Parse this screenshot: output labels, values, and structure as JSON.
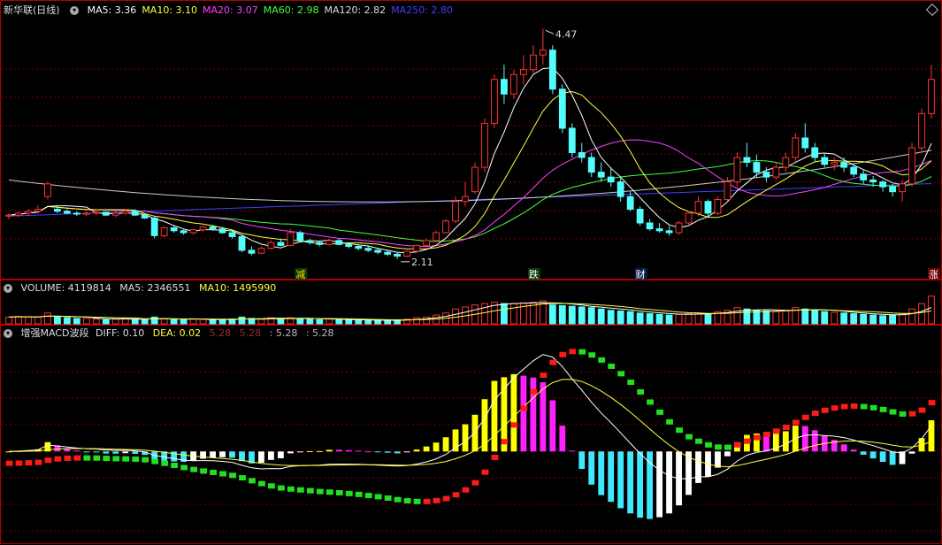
{
  "app": {
    "stock_name": "新华联",
    "period": "(日线)"
  },
  "main_indicators": [
    {
      "label": "MA5: 3.36",
      "color": "#ffffff"
    },
    {
      "label": "MA10: 3.10",
      "color": "#ffff40"
    },
    {
      "label": "MA20: 3.07",
      "color": "#ff40ff"
    },
    {
      "label": "MA60: 2.98",
      "color": "#40ff40"
    },
    {
      "label": "MA120: 2.82",
      "color": "#dddddd"
    },
    {
      "label": "MA250: 2.80",
      "color": "#4040ff"
    }
  ],
  "volume_panel": {
    "title": "VOLUME: 4119814",
    "ma5": "MA5: 2346551",
    "ma10": "MA10: 1495990"
  },
  "macd_panel": {
    "title": "增强MACD波段",
    "diff": "DIFF: 0.10",
    "dea": "DEA: 0.02",
    "extra": [
      "5.28",
      "5.28",
      ": 5.28",
      ": 5.28"
    ]
  },
  "annotations": {
    "high": "4.47",
    "low": "2.11",
    "markers": [
      "减",
      "跌",
      "财",
      "涨"
    ]
  },
  "colors": {
    "up": "#ff3232",
    "down": "#54fcfc",
    "grid": "#7a0000",
    "border": "#b00000"
  },
  "chart_data": {
    "type": "candlestick",
    "price_ylim": [
      1.9,
      4.6
    ],
    "high_value": 4.47,
    "low_value": 2.11,
    "candles": [
      [
        2.55,
        2.58,
        2.52,
        2.56
      ],
      [
        2.56,
        2.6,
        2.54,
        2.58
      ],
      [
        2.58,
        2.62,
        2.55,
        2.6
      ],
      [
        2.6,
        2.66,
        2.58,
        2.62
      ],
      [
        2.75,
        2.9,
        2.72,
        2.88
      ],
      [
        2.62,
        2.66,
        2.58,
        2.6
      ],
      [
        2.6,
        2.62,
        2.57,
        2.58
      ],
      [
        2.58,
        2.6,
        2.55,
        2.57
      ],
      [
        2.57,
        2.6,
        2.55,
        2.58
      ],
      [
        2.58,
        2.61,
        2.56,
        2.59
      ],
      [
        2.59,
        2.6,
        2.55,
        2.56
      ],
      [
        2.56,
        2.6,
        2.54,
        2.58
      ],
      [
        2.58,
        2.62,
        2.56,
        2.6
      ],
      [
        2.6,
        2.62,
        2.55,
        2.56
      ],
      [
        2.56,
        2.58,
        2.52,
        2.53
      ],
      [
        2.53,
        2.55,
        2.32,
        2.35
      ],
      [
        2.35,
        2.45,
        2.33,
        2.43
      ],
      [
        2.43,
        2.45,
        2.38,
        2.4
      ],
      [
        2.4,
        2.42,
        2.36,
        2.38
      ],
      [
        2.38,
        2.42,
        2.36,
        2.41
      ],
      [
        2.41,
        2.45,
        2.39,
        2.44
      ],
      [
        2.44,
        2.46,
        2.4,
        2.42
      ],
      [
        2.42,
        2.44,
        2.37,
        2.38
      ],
      [
        2.38,
        2.4,
        2.32,
        2.34
      ],
      [
        2.34,
        2.36,
        2.18,
        2.2
      ],
      [
        2.2,
        2.24,
        2.15,
        2.17
      ],
      [
        2.17,
        2.24,
        2.16,
        2.22
      ],
      [
        2.22,
        2.3,
        2.21,
        2.28
      ],
      [
        2.28,
        2.32,
        2.24,
        2.25
      ],
      [
        2.25,
        2.42,
        2.24,
        2.38
      ],
      [
        2.38,
        2.4,
        2.28,
        2.3
      ],
      [
        2.3,
        2.32,
        2.26,
        2.28
      ],
      [
        2.28,
        2.3,
        2.24,
        2.26
      ],
      [
        2.26,
        2.32,
        2.25,
        2.3
      ],
      [
        2.3,
        2.32,
        2.25,
        2.26
      ],
      [
        2.26,
        2.28,
        2.22,
        2.24
      ],
      [
        2.24,
        2.26,
        2.2,
        2.22
      ],
      [
        2.22,
        2.24,
        2.18,
        2.2
      ],
      [
        2.2,
        2.22,
        2.16,
        2.18
      ],
      [
        2.18,
        2.2,
        2.14,
        2.16
      ],
      [
        2.16,
        2.18,
        2.11,
        2.14
      ],
      [
        2.14,
        2.2,
        2.13,
        2.19
      ],
      [
        2.19,
        2.26,
        2.18,
        2.25
      ],
      [
        2.25,
        2.32,
        2.24,
        2.3
      ],
      [
        2.3,
        2.4,
        2.29,
        2.38
      ],
      [
        2.38,
        2.52,
        2.37,
        2.5
      ],
      [
        2.5,
        2.75,
        2.48,
        2.7
      ],
      [
        2.7,
        2.9,
        2.65,
        2.75
      ],
      [
        2.8,
        3.1,
        2.78,
        3.05
      ],
      [
        3.05,
        3.55,
        3.0,
        3.5
      ],
      [
        3.5,
        4.0,
        3.45,
        3.95
      ],
      [
        3.95,
        4.1,
        3.7,
        3.8
      ],
      [
        3.8,
        4.05,
        3.75,
        4.0
      ],
      [
        4.0,
        4.2,
        3.9,
        4.05
      ],
      [
        4.05,
        4.3,
        4.0,
        4.2
      ],
      [
        4.2,
        4.47,
        4.1,
        4.25
      ],
      [
        4.25,
        4.3,
        3.8,
        3.85
      ],
      [
        3.85,
        3.9,
        3.4,
        3.45
      ],
      [
        3.45,
        3.5,
        3.15,
        3.2
      ],
      [
        3.2,
        3.3,
        3.1,
        3.15
      ],
      [
        3.15,
        3.2,
        2.95,
        3.0
      ],
      [
        3.0,
        3.1,
        2.9,
        2.95
      ],
      [
        2.95,
        3.05,
        2.85,
        2.9
      ],
      [
        2.9,
        2.95,
        2.7,
        2.75
      ],
      [
        2.75,
        2.8,
        2.6,
        2.62
      ],
      [
        2.62,
        2.65,
        2.45,
        2.48
      ],
      [
        2.48,
        2.52,
        2.4,
        2.42
      ],
      [
        2.42,
        2.48,
        2.38,
        2.4
      ],
      [
        2.4,
        2.45,
        2.35,
        2.38
      ],
      [
        2.38,
        2.5,
        2.36,
        2.48
      ],
      [
        2.48,
        2.6,
        2.45,
        2.58
      ],
      [
        2.58,
        2.75,
        2.55,
        2.7
      ],
      [
        2.7,
        2.72,
        2.55,
        2.58
      ],
      [
        2.58,
        2.75,
        2.56,
        2.72
      ],
      [
        2.72,
        2.95,
        2.7,
        2.9
      ],
      [
        2.9,
        3.2,
        2.85,
        3.15
      ],
      [
        3.15,
        3.3,
        3.05,
        3.1
      ],
      [
        3.1,
        3.18,
        2.95,
        3.0
      ],
      [
        3.0,
        3.05,
        2.9,
        2.95
      ],
      [
        2.95,
        3.1,
        2.92,
        3.05
      ],
      [
        3.05,
        3.2,
        3.0,
        3.15
      ],
      [
        3.15,
        3.4,
        3.1,
        3.35
      ],
      [
        3.35,
        3.5,
        3.2,
        3.25
      ],
      [
        3.25,
        3.3,
        3.1,
        3.15
      ],
      [
        3.15,
        3.2,
        3.05,
        3.08
      ],
      [
        3.08,
        3.15,
        3.02,
        3.1
      ],
      [
        3.1,
        3.15,
        3.0,
        3.05
      ],
      [
        3.05,
        3.08,
        2.95,
        2.98
      ],
      [
        2.98,
        3.02,
        2.88,
        2.92
      ],
      [
        2.92,
        2.96,
        2.85,
        2.9
      ],
      [
        2.9,
        2.92,
        2.8,
        2.85
      ],
      [
        2.85,
        2.88,
        2.75,
        2.8
      ],
      [
        2.8,
        2.92,
        2.7,
        2.88
      ],
      [
        2.88,
        3.3,
        2.85,
        3.25
      ],
      [
        3.25,
        3.65,
        3.2,
        3.6
      ],
      [
        3.6,
        4.1,
        3.55,
        3.95
      ]
    ],
    "volume": [
      1.0,
      1.1,
      1.0,
      1.0,
      1.6,
      1.0,
      0.9,
      0.8,
      0.8,
      0.7,
      0.6,
      0.7,
      0.8,
      0.7,
      0.6,
      1.0,
      0.8,
      0.6,
      0.6,
      0.7,
      0.7,
      0.6,
      0.6,
      0.7,
      1.0,
      0.8,
      0.7,
      0.9,
      0.8,
      0.9,
      0.8,
      0.7,
      0.6,
      0.7,
      0.6,
      0.6,
      0.5,
      0.5,
      0.5,
      0.5,
      0.6,
      0.7,
      0.9,
      1.0,
      1.3,
      1.6,
      2.2,
      2.5,
      2.8,
      3.0,
      3.2,
      3.0,
      3.0,
      3.1,
      3.2,
      3.4,
      2.8,
      2.7,
      2.6,
      2.5,
      2.4,
      2.2,
      2.0,
      1.9,
      1.8,
      1.6,
      1.5,
      1.4,
      1.3,
      1.4,
      1.5,
      1.6,
      1.5,
      1.8,
      2.0,
      2.4,
      2.2,
      2.0,
      1.9,
      1.8,
      2.0,
      2.4,
      2.2,
      2.0,
      1.8,
      1.7,
      1.6,
      1.5,
      1.4,
      1.3,
      1.2,
      1.3,
      1.5,
      2.2,
      3.0,
      4.1
    ],
    "volume_max": 4.2,
    "macd_ylim": [
      -0.45,
      0.55
    ]
  }
}
